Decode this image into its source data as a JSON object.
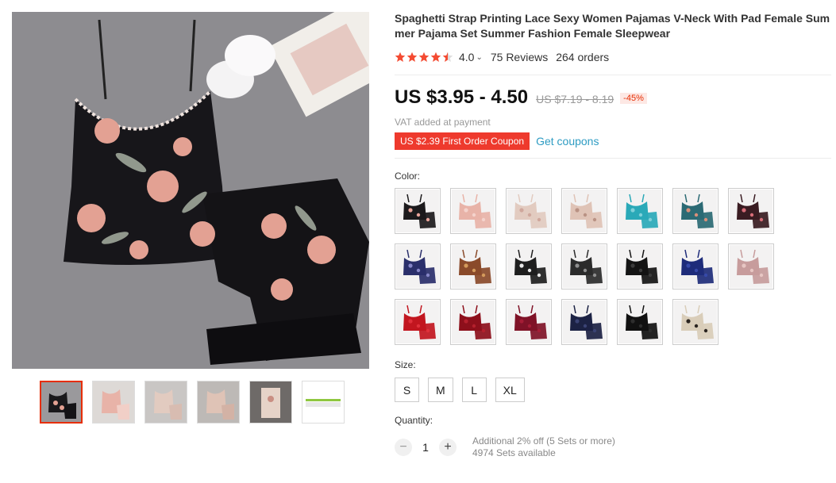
{
  "product": {
    "title": "Spaghetti Strap Printing Lace Sexy Women Pajamas V-Neck With Pad Female Summer Pajama Set Summer Fashion Female Sleepwear",
    "rating": "4.0",
    "reviews": "75 Reviews",
    "orders": "264 orders",
    "stars_filled_fraction": 0.8
  },
  "price": {
    "current": "US $3.95 - 4.50",
    "original": "US $7.19 - 8.19",
    "discount": "-45%",
    "vat": "VAT added at payment",
    "coupon": "US $2.39 First Order Coupon",
    "get_coupons": "Get coupons"
  },
  "color": {
    "label": "Color:",
    "options": [
      {
        "name": "black-floral-with-pads",
        "top": "#1c1a1c",
        "accent": "#e9a49a"
      },
      {
        "name": "pink-floral",
        "top": "#e8b3a8",
        "accent": "#f4d3cc"
      },
      {
        "name": "beige-floral",
        "top": "#e2cbc0",
        "accent": "#cfa79c"
      },
      {
        "name": "cream-floral",
        "top": "#dfc3b6",
        "accent": "#b99284"
      },
      {
        "name": "aqua",
        "top": "#2aa9b8",
        "accent": "#7fd0d9"
      },
      {
        "name": "teal-floral",
        "top": "#2b6a74",
        "accent": "#d88f7a"
      },
      {
        "name": "burgundy-floral",
        "top": "#3a1c22",
        "accent": "#d76d78"
      },
      {
        "name": "navy-print",
        "top": "#2a2f6b",
        "accent": "#8686c8"
      },
      {
        "name": "leopard",
        "top": "#8a4a2a",
        "accent": "#d49a5b"
      },
      {
        "name": "black-white-floral",
        "top": "#1e1e1e",
        "accent": "#e9e9e9"
      },
      {
        "name": "dark-floral",
        "top": "#2b2b2b",
        "accent": "#8f8f8f"
      },
      {
        "name": "black-lace",
        "top": "#141414",
        "accent": "#3c3c3c"
      },
      {
        "name": "navy-blue",
        "top": "#1e2c7a",
        "accent": "#3649a8"
      },
      {
        "name": "dusty-pink",
        "top": "#c79c9c",
        "accent": "#e7c6c3"
      },
      {
        "name": "red",
        "top": "#c2161f",
        "accent": "#e0303a"
      },
      {
        "name": "wine-red",
        "top": "#8d0f1b",
        "accent": "#b4202d"
      },
      {
        "name": "burgundy",
        "top": "#7f1227",
        "accent": "#a51d36"
      },
      {
        "name": "navy-lace",
        "top": "#1c2244",
        "accent": "#3a4374"
      },
      {
        "name": "black-satin",
        "top": "#111111",
        "accent": "#2e2e2e"
      },
      {
        "name": "champagne",
        "top": "#d9cdb9",
        "accent": "#2a2420"
      }
    ]
  },
  "size": {
    "label": "Size:",
    "options": [
      "S",
      "M",
      "L",
      "XL"
    ]
  },
  "quantity": {
    "label": "Quantity:",
    "value": "1",
    "minus": "−",
    "plus": "+",
    "promo": "Additional 2% off (5 Sets or more)",
    "available": "4974 Sets available"
  },
  "colors": {
    "accent_red": "#e62e04",
    "link_blue": "#2e9cc3",
    "star_red": "#f44b32"
  }
}
